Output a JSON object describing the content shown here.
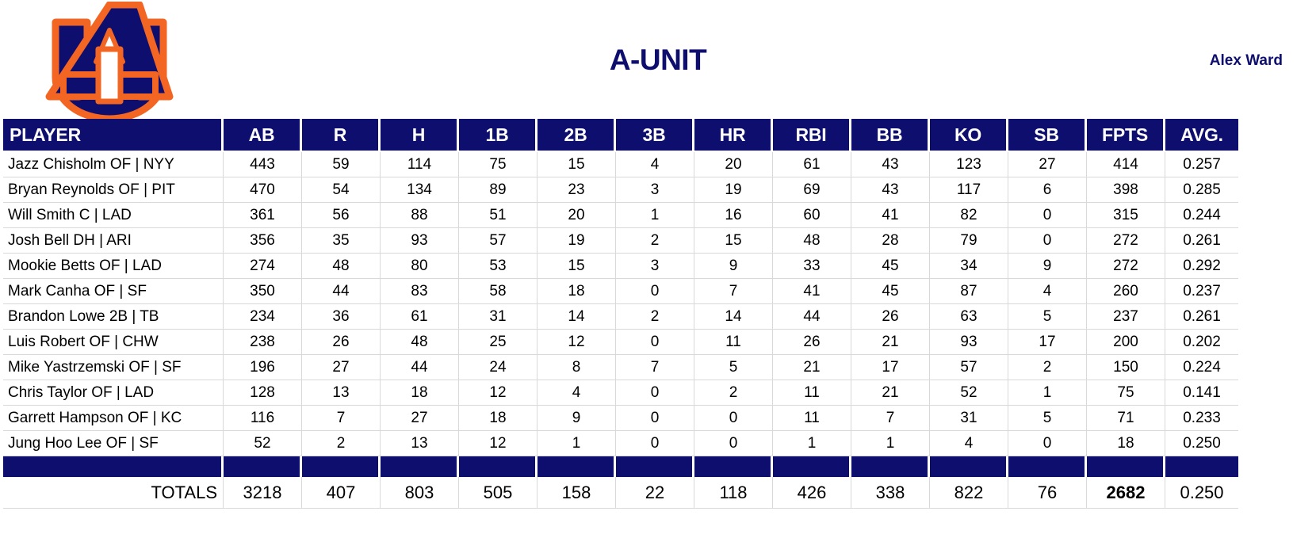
{
  "header": {
    "logo_alt": "Auburn AU logo",
    "logo_navy": "#0e0e6e",
    "logo_orange": "#f26522",
    "title": "A-UNIT",
    "owner": "Alex Ward"
  },
  "colors": {
    "navy": "#0e0e6e",
    "orange": "#f26522",
    "grid": "#d9d9d9",
    "text": "#000000"
  },
  "table": {
    "columns": [
      "PLAYER",
      "AB",
      "R",
      "H",
      "1B",
      "2B",
      "3B",
      "HR",
      "RBI",
      "BB",
      "KO",
      "SB",
      "FPTS",
      "AVG."
    ],
    "rows": [
      {
        "player": "Jazz Chisholm OF | NYY",
        "AB": "443",
        "R": "59",
        "H": "114",
        "1B": "75",
        "2B": "15",
        "3B": "4",
        "HR": "20",
        "RBI": "61",
        "BB": "43",
        "KO": "123",
        "SB": "27",
        "FPTS": "414",
        "AVG": "0.257"
      },
      {
        "player": "Bryan Reynolds OF | PIT",
        "AB": "470",
        "R": "54",
        "H": "134",
        "1B": "89",
        "2B": "23",
        "3B": "3",
        "HR": "19",
        "RBI": "69",
        "BB": "43",
        "KO": "117",
        "SB": "6",
        "FPTS": "398",
        "AVG": "0.285"
      },
      {
        "player": "Will Smith C | LAD",
        "AB": "361",
        "R": "56",
        "H": "88",
        "1B": "51",
        "2B": "20",
        "3B": "1",
        "HR": "16",
        "RBI": "60",
        "BB": "41",
        "KO": "82",
        "SB": "0",
        "FPTS": "315",
        "AVG": "0.244"
      },
      {
        "player": "Josh Bell DH | ARI",
        "AB": "356",
        "R": "35",
        "H": "93",
        "1B": "57",
        "2B": "19",
        "3B": "2",
        "HR": "15",
        "RBI": "48",
        "BB": "28",
        "KO": "79",
        "SB": "0",
        "FPTS": "272",
        "AVG": "0.261"
      },
      {
        "player": "Mookie Betts OF | LAD",
        "AB": "274",
        "R": "48",
        "H": "80",
        "1B": "53",
        "2B": "15",
        "3B": "3",
        "HR": "9",
        "RBI": "33",
        "BB": "45",
        "KO": "34",
        "SB": "9",
        "FPTS": "272",
        "AVG": "0.292"
      },
      {
        "player": "Mark Canha OF | SF",
        "AB": "350",
        "R": "44",
        "H": "83",
        "1B": "58",
        "2B": "18",
        "3B": "0",
        "HR": "7",
        "RBI": "41",
        "BB": "45",
        "KO": "87",
        "SB": "4",
        "FPTS": "260",
        "AVG": "0.237"
      },
      {
        "player": "Brandon Lowe 2B | TB",
        "AB": "234",
        "R": "36",
        "H": "61",
        "1B": "31",
        "2B": "14",
        "3B": "2",
        "HR": "14",
        "RBI": "44",
        "BB": "26",
        "KO": "63",
        "SB": "5",
        "FPTS": "237",
        "AVG": "0.261"
      },
      {
        "player": "Luis Robert OF | CHW",
        "AB": "238",
        "R": "26",
        "H": "48",
        "1B": "25",
        "2B": "12",
        "3B": "0",
        "HR": "11",
        "RBI": "26",
        "BB": "21",
        "KO": "93",
        "SB": "17",
        "FPTS": "200",
        "AVG": "0.202"
      },
      {
        "player": "Mike Yastrzemski OF | SF",
        "AB": "196",
        "R": "27",
        "H": "44",
        "1B": "24",
        "2B": "8",
        "3B": "7",
        "HR": "5",
        "RBI": "21",
        "BB": "17",
        "KO": "57",
        "SB": "2",
        "FPTS": "150",
        "AVG": "0.224"
      },
      {
        "player": "Chris Taylor OF | LAD",
        "AB": "128",
        "R": "13",
        "H": "18",
        "1B": "12",
        "2B": "4",
        "3B": "0",
        "HR": "2",
        "RBI": "11",
        "BB": "21",
        "KO": "52",
        "SB": "1",
        "FPTS": "75",
        "AVG": "0.141"
      },
      {
        "player": "Garrett Hampson OF | KC",
        "AB": "116",
        "R": "7",
        "H": "27",
        "1B": "18",
        "2B": "9",
        "3B": "0",
        "HR": "0",
        "RBI": "11",
        "BB": "7",
        "KO": "31",
        "SB": "5",
        "FPTS": "71",
        "AVG": "0.233"
      },
      {
        "player": "Jung Hoo Lee OF | SF",
        "AB": "52",
        "R": "2",
        "H": "13",
        "1B": "12",
        "2B": "1",
        "3B": "0",
        "HR": "0",
        "RBI": "1",
        "BB": "1",
        "KO": "4",
        "SB": "0",
        "FPTS": "18",
        "AVG": "0.250"
      }
    ],
    "totals": {
      "label": "TOTALS",
      "AB": "3218",
      "R": "407",
      "H": "803",
      "1B": "505",
      "2B": "158",
      "3B": "22",
      "HR": "118",
      "RBI": "426",
      "BB": "338",
      "KO": "822",
      "SB": "76",
      "FPTS": "2682",
      "AVG": "0.250"
    }
  }
}
